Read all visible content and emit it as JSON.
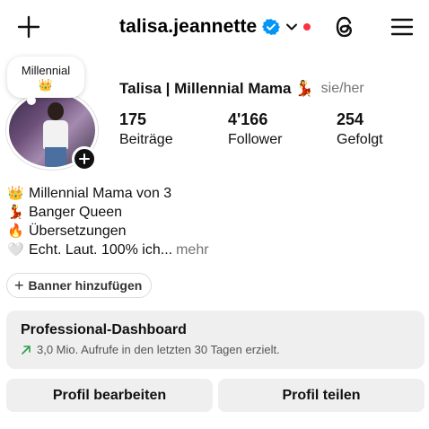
{
  "header": {
    "username": "talisa.jeannette",
    "icons": {
      "create": "plus-icon",
      "verified": "verified-badge-icon",
      "switch": "chevron-down-icon",
      "threads": "threads-icon",
      "menu": "hamburger-menu-icon"
    },
    "notification_dot_color": "#ff3040",
    "verified_color": "#0095f6"
  },
  "note": {
    "text": "Millennial",
    "emoji": "👑"
  },
  "profile": {
    "display_name": "Talisa | Millennial Mama",
    "display_name_emoji": "💃",
    "pronouns": "sie/her"
  },
  "stats": [
    {
      "value": "175",
      "label": "Beiträge"
    },
    {
      "value": "4'166",
      "label": "Follower"
    },
    {
      "value": "254",
      "label": "Gefolgt"
    }
  ],
  "bio": [
    {
      "emoji": "👑",
      "text": "Millennial Mama von 3"
    },
    {
      "emoji": "💃",
      "text": "Banger Queen"
    },
    {
      "emoji": "🔥",
      "text": "Übersetzungen"
    },
    {
      "emoji": "🤍",
      "text": "Echt. Laut. 100% ich..."
    }
  ],
  "bio_more": "mehr",
  "banner_button": {
    "label": "Banner hinzufügen"
  },
  "dashboard": {
    "title": "Professional-Dashboard",
    "subtitle": "3,0 Mio. Aufrufe in den letzten 30 Tagen erzielt.",
    "trend_color": "#2a9d4a"
  },
  "actions": {
    "edit": "Profil bearbeiten",
    "share": "Profil teilen"
  }
}
